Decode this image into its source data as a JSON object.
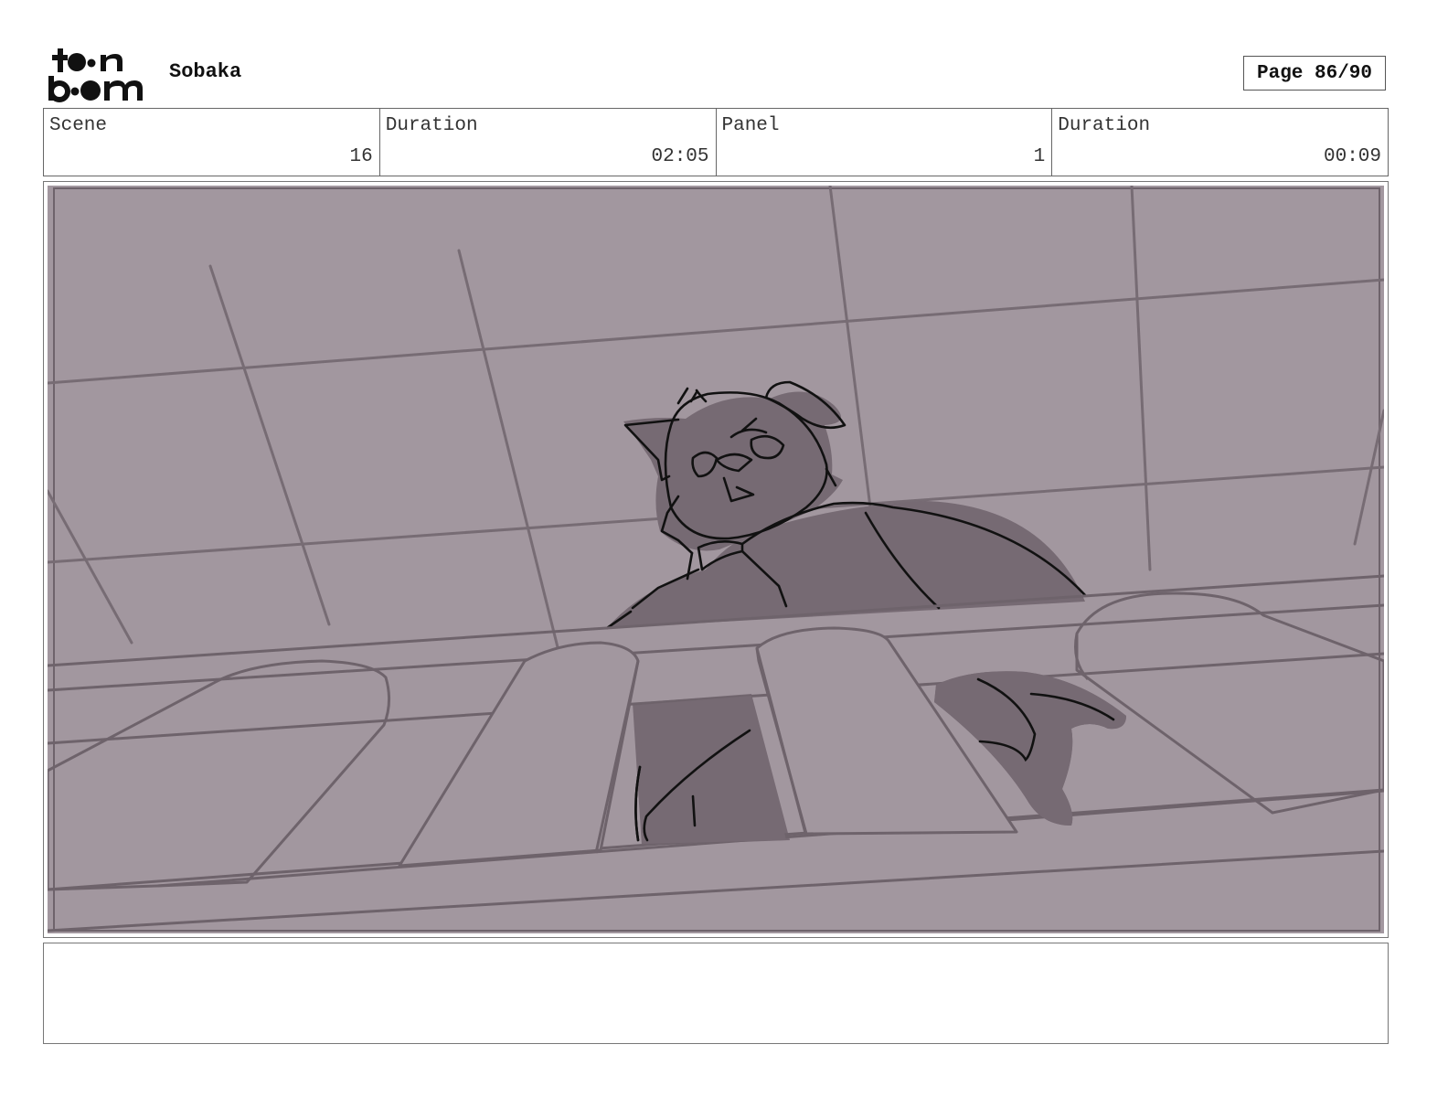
{
  "header": {
    "logo_text": "toon boom",
    "project_title": "Sobaka",
    "page_label": "Page 86/90"
  },
  "info": {
    "scene_label": "Scene",
    "scene_value": "16",
    "scene_duration_label": "Duration",
    "scene_duration_value": "02:05",
    "panel_label": "Panel",
    "panel_value": "1",
    "panel_duration_label": "Duration",
    "panel_duration_value": "00:09"
  },
  "panel": {
    "description": "",
    "colors": {
      "background": "#a2979f",
      "line": "#6e636b",
      "fill_dark": "#766a73",
      "ink": "#111111"
    }
  },
  "notes": {
    "text": ""
  }
}
